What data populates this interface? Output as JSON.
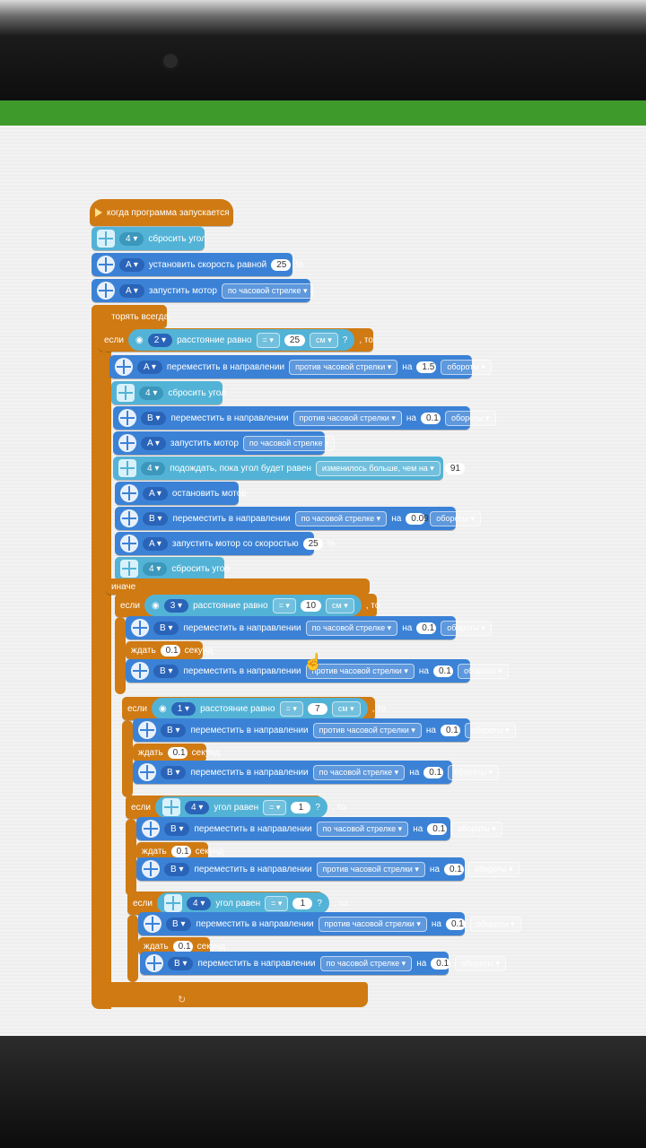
{
  "program": {
    "hat_label": "когда программа запускается",
    "forever_label": "повторять всегда",
    "else_label": "иначе",
    "if_label": "если",
    "then_label": ", то",
    "wait_label": "ждать",
    "seconds_label": "секунд",
    "reset_angle_label": "сбросить угол",
    "set_speed_label": "установить скорость равной",
    "start_motor_label": "запустить мотор",
    "move_dir_label": "переместить в направлении",
    "on_label": "на",
    "wait_until_label": "подождать, пока угол будет равен",
    "stop_motor_label": "остановить мотор",
    "start_speed_label": "запустить мотор со скоростью",
    "distance_label": "расстояние равно",
    "angle_label": "угол равен",
    "dir_ccw": "против часовой стрелки ▾",
    "dir_cw": "по часовой стрелке ▾",
    "rotations": "обороты ▾",
    "cm": "см ▾",
    "changed_more": "изменилось больше, чем на ▾",
    "percent": "%",
    "eq": "= ▾",
    "q": "?"
  },
  "ports": {
    "A": "A ▾",
    "B": "B ▾",
    "four": "4 ▾",
    "two": "2 ▾",
    "three": "3 ▾",
    "one": "1 ▾"
  },
  "values": {
    "speed1": "25",
    "dist1": "25",
    "rot1": "1.5",
    "rot2": "0.1",
    "angle91": "91",
    "rot3": "0.09",
    "speed2": "25",
    "dist2": "10",
    "rot4": "0.1",
    "wait1": "0.1",
    "rot5": "0.1",
    "dist3": "7",
    "rot6": "0.1",
    "wait2": "0.1",
    "rot7": "0.1",
    "ang1": "1",
    "rot8": "0.1",
    "wait3": "0.1",
    "rot9": "0.1",
    "ang2": "1",
    "rot10": "0.1",
    "wait4": "0.1",
    "rot11": "0.1"
  },
  "colors": {
    "motor": "#3b82d6",
    "sensor": "#53b3d6",
    "control": "#cf7a12"
  }
}
